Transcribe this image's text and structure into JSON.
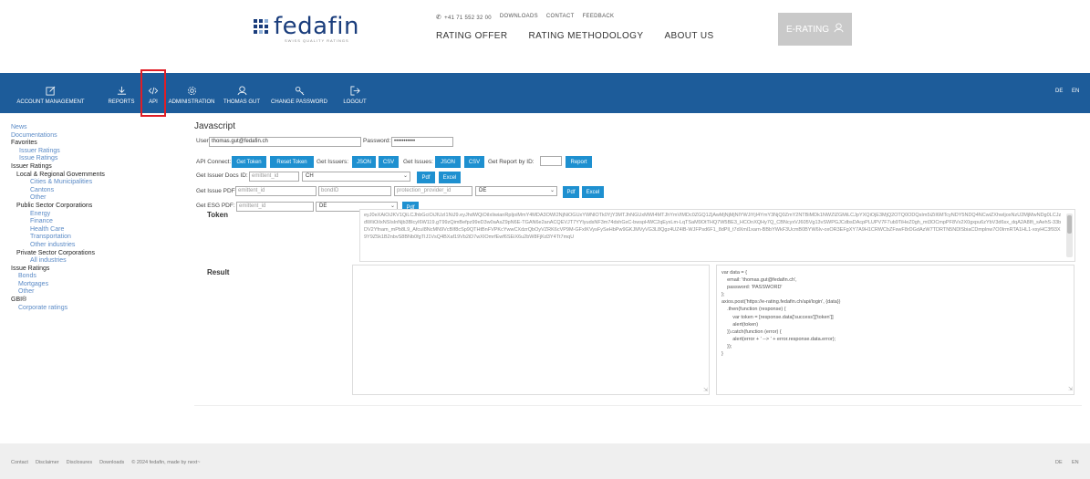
{
  "header": {
    "logo_text": "fedafin",
    "logo_tagline": "SWISS QUALITY RATINGS",
    "phone": "+41 71 552 32 00",
    "top_links": [
      "DOWNLOADS",
      "CONTACT",
      "FEEDBACK"
    ],
    "main_nav": [
      "RATING OFFER",
      "RATING METHODOLOGY",
      "ABOUT US"
    ],
    "erating_label": "E-RATING"
  },
  "navbar": {
    "items": [
      {
        "label": "ACCOUNT MANAGEMENT",
        "icon": "edit-icon"
      },
      {
        "label": "REPORTS",
        "icon": "download-icon"
      },
      {
        "label": "API",
        "icon": "code-icon"
      },
      {
        "label": "ADMINISTRATION",
        "icon": "gear-icon"
      },
      {
        "label": "THOMAS GUT",
        "icon": "user-icon"
      },
      {
        "label": "CHANGE PASSWORD",
        "icon": "key-icon"
      },
      {
        "label": "LOGOUT",
        "icon": "logout-icon"
      }
    ],
    "lang_de": "DE",
    "lang_en": "EN"
  },
  "sidebar": {
    "news": "News",
    "documentations": "Documentations",
    "favorites": "Favorites",
    "fav_issuer_ratings": "Issuer Ratings",
    "fav_issue_ratings": "Issue Ratings",
    "issuer_ratings": "Issuer Ratings",
    "local_regional": "Local & Regional Governments",
    "cities": "Cities & Municipalities",
    "cantons": "Cantons",
    "lr_other": "Other",
    "public_sector": "Public Sector Corporations",
    "energy": "Energy",
    "finance": "Finance",
    "health_care": "Health Care",
    "transportation": "Transportation",
    "other_industries": "Other industries",
    "private_sector": "Private Sector Corporations",
    "all_industries": "All industries",
    "issue_ratings": "Issue Ratings",
    "bonds": "Bonds",
    "mortgages": "Mortgages",
    "ir_other": "Other",
    "gbi": "GBI®",
    "corporate_ratings": "Corporate ratings"
  },
  "form": {
    "title": "Javascript",
    "user_label": "User:",
    "user_value": "thomas.gut@fedafin.ch",
    "password_label": "Password:",
    "password_value": "•••••••••••",
    "api_connect_label": "API Connect:",
    "get_token": "Get Token",
    "reset_token": "Reset Token",
    "get_issuers_label": "Get Issuers:",
    "json": "JSON",
    "csv": "CSV",
    "get_issues_label": "Get Issues:",
    "get_report_label": "Get Report by ID:",
    "report": "Report",
    "issuer_docs_label": "Get Issuer Docs ID:",
    "emittent_placeholder": "emittent_id",
    "ch": "CH",
    "pdf": "Pdf",
    "excel": "Excel",
    "issue_pdf_label": "Get Issue PDF:",
    "bondid_placeholder": "bondID",
    "protection_placeholder": "protection_provider_id",
    "de": "DE",
    "esg_pdf_label": "Get ESG PDF:"
  },
  "token": {
    "label": "Token",
    "value": "eyJ0eXAiOiJKV1QiLCJhbGciOiJIUzI1NiJ9.eyJhdWQiOiIxIiwianRpIjoiMmY4MDA3OWI2NjNiOGUxYWNlOTk0YjY3MTJhNGUxMWI4MTJhYmVlMDc0ZGQ1ZjAwMjNjMjNlYWJiYjI4YmY3NjQ0ZmY2NTBiMDk1NWZlZGMiLCJpYXQiOjE3MjQ2OTQ0ODQsIm5iZiI6MTcyNDY5NDQ4NCwiZXhwIjoxNzU2MjMwNDg0LCJzdWIiOiIxNSIsInNjb3BlcyI6W119.gT99zQimBefpz99eD3w0aAsZ9pN6E-TGAN6e2anACQEVJT7YYlyudsNF3m74dshGxC-bwspHWC2qEyxLm-LqTSaM9OtTHQ7W5BE3_HCOnXQHy7Q_CBNcyxVJ605Vg13vSWPGJCdbsDAcpPLUPV7F7ub9TiHeZ0gh_mt3OCmpPF8Vx2X0gxpu6zYbV3d6sx_dqA2A8Ifi_sAehS-33bDV2Yfnam_mPb8L9_AfcuI8NcMN9VcBIf8cSp9QTHtBnFVPKcYwwCXdzrQbOyVZRK6cVP9M-GFxIKVysFySeHbPw9GKJMVyVG3L8Qgz4UZ4lB-WJFPsd6F1_8dPll_t7dXml1xarn-BBbYWkF3UcmB0BYW6lv-oxOR3EFgXY7A9H1CRWCbZFswF8rDGdAzW7TDRTN5NDlSbiaCDmplnw7O0IrmRTA1HL1-xsyHC3f93X9Y9Z5k1B2nbvS8BNb0fgTIJ1VsQ4BXaf19Vb2iD7wXIOmrfEwf6SEiX6u2bW8FjKd3Y4Tt7mqU"
  },
  "result": {
    "label": "Result",
    "code_lines": [
      "var data = {",
      "    email: 'thomas.gut@fedafin.ch',",
      "    password: 'PASSWORD'",
      "};",
      "axios.post('https://e-rating.fedafin.ch/api/login', {data})",
      "    .then(function (response) {",
      "        var token = [response.data['success']['token']]",
      "        alert(token)",
      "    }).catch(function (error) {",
      "        alert(error + ' --> ' + error.response.data.error);",
      "    });",
      "}"
    ]
  },
  "footer": {
    "links": [
      "Contact",
      "Disclaimer",
      "Disclosures",
      "Downloads"
    ],
    "copyright": "© 2024 fedafin, made by next~",
    "lang_de": "DE",
    "lang_en": "EN"
  },
  "colors": {
    "navbar": "#1d5c9a",
    "button": "#1e90d0",
    "highlight": "#e01e26",
    "link": "#5a8ac6"
  }
}
